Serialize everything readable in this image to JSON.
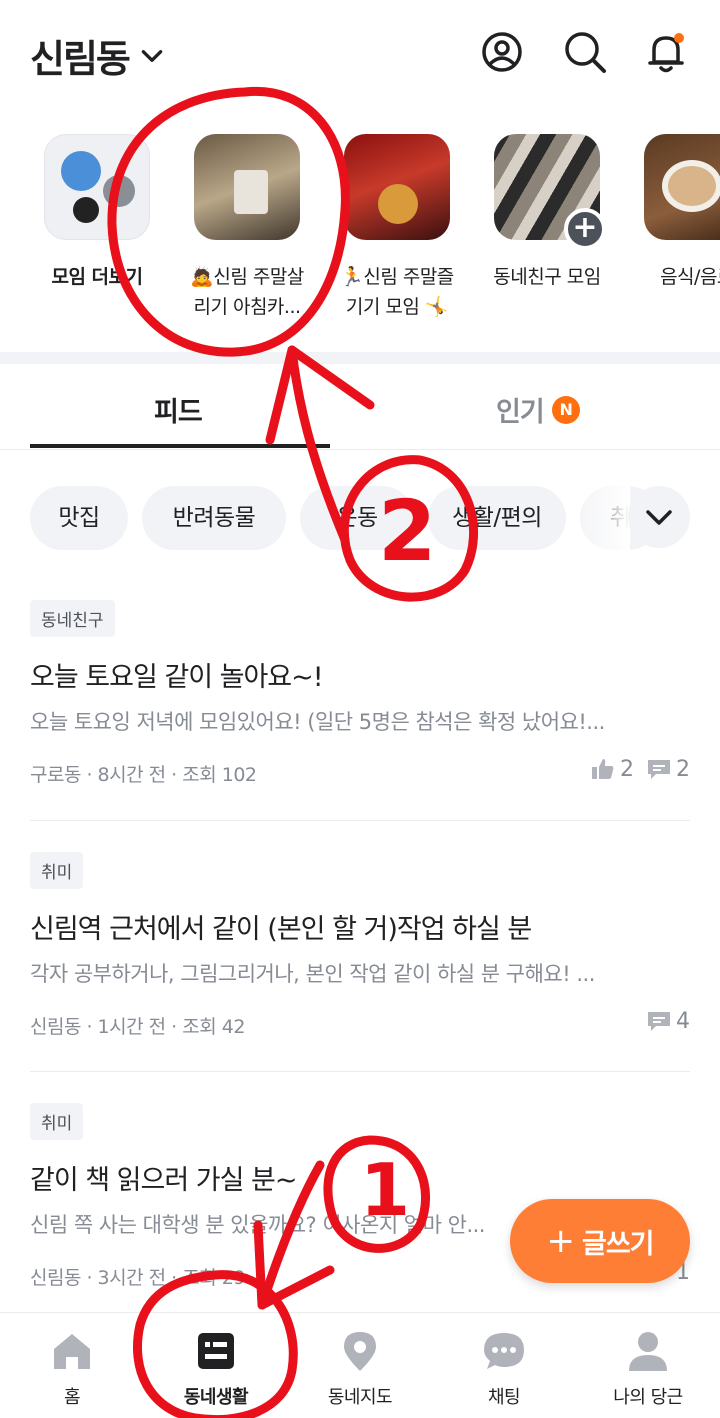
{
  "header": {
    "location": "신림동",
    "icons": [
      "chevron-down-icon",
      "profile-icon",
      "search-icon",
      "bell-icon"
    ],
    "accent": "#ff6f0f"
  },
  "stories": [
    {
      "label": "모임 더보기",
      "bold": true
    },
    {
      "label": "🙇신림 주말살리기 아침카...",
      "line1": "🙇신림 주말살",
      "line2": "리기 아침카..."
    },
    {
      "label": "🏃신림 주말즐기기 모임 🤸",
      "line1": "🏃신림 주말즐",
      "line2": "기기 모임 🤸"
    },
    {
      "label": "동네친구 모임",
      "line1": "동네친구 모임"
    },
    {
      "label": "음식/음료",
      "line1": "음식/음료"
    }
  ],
  "tabs": {
    "feed": "피드",
    "popular": "인기",
    "popular_badge": "N"
  },
  "chips": [
    "맛집",
    "반려동물",
    "운동",
    "생활/편의",
    "취"
  ],
  "posts": [
    {
      "tag": "동네친구",
      "title": "오늘 토요일 같이 놀아요~!",
      "body": "오늘 토요잉 저녁에 모임있어요! (일단 5명은 참석은 확정 났어요!...",
      "meta": "구로동 · 8시간 전 · 조회 102",
      "likes": "2",
      "comments": "2"
    },
    {
      "tag": "취미",
      "title": "신림역 근처에서 같이 (본인 할 거)작업 하실 분",
      "body": "각자 공부하거나, 그림그리거나, 본인 작업 같이 하실 분 구해요! ...",
      "meta": "신림동 · 1시간 전 · 조회 42",
      "comments": "4"
    },
    {
      "tag": "취미",
      "title": "같이 책 읽으러 가실 분~",
      "body": "신림 쪽 사는 대학생 분 있을까요? 이사온지 얼마 안...",
      "meta": "신림동 · 3시간 전 · 조회 29",
      "comments": "1"
    }
  ],
  "write_button": {
    "plus": "+",
    "label": "글쓰기"
  },
  "bottom_nav": [
    {
      "label": "홈",
      "icon": "home-icon"
    },
    {
      "label": "동네생활",
      "icon": "community-icon",
      "active": true
    },
    {
      "label": "동네지도",
      "icon": "map-pin-icon"
    },
    {
      "label": "채팅",
      "icon": "chat-icon"
    },
    {
      "label": "나의 당근",
      "icon": "user-icon"
    }
  ],
  "annotations": {
    "num1": "1",
    "num2": "2",
    "color": "#e8101a"
  }
}
